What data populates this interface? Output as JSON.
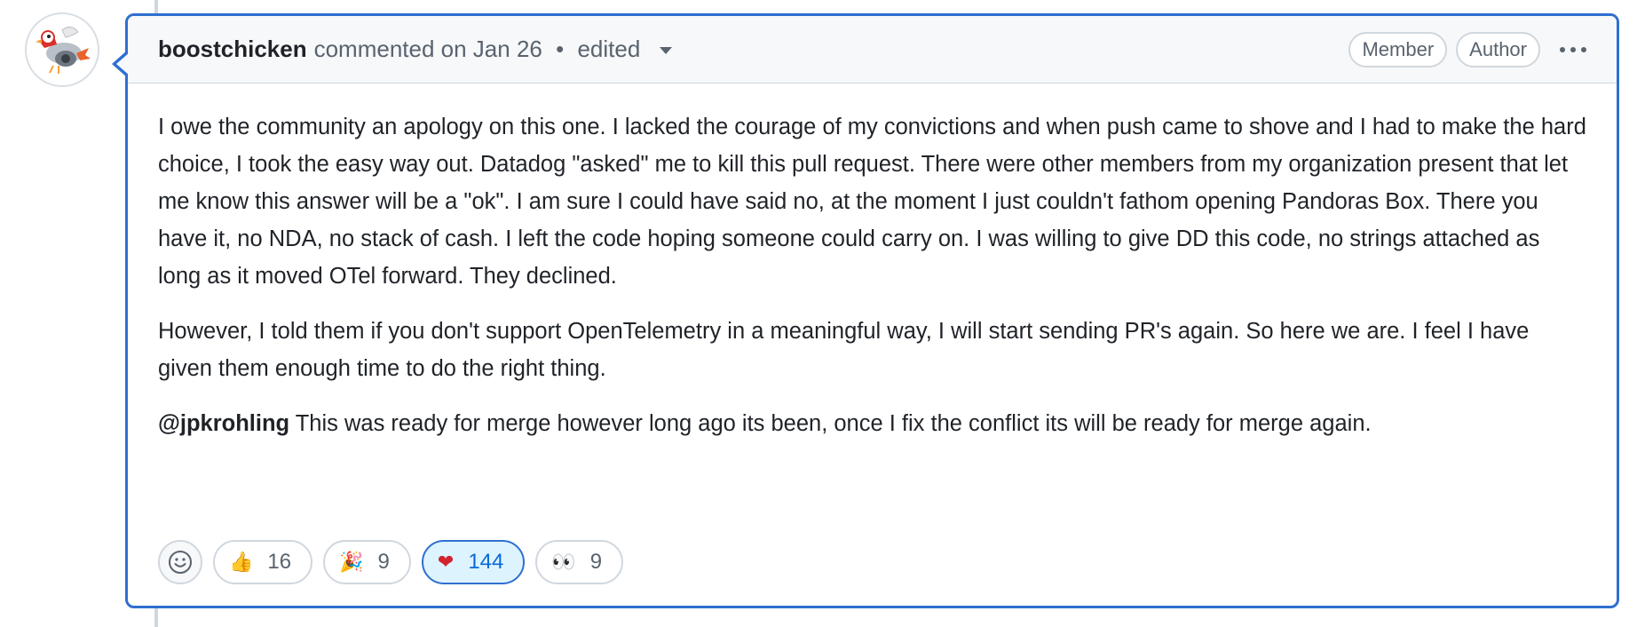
{
  "comment": {
    "author": "boostchicken",
    "action": "commented on Jan 26",
    "separator": "•",
    "edited": "edited",
    "badges": [
      "Member",
      "Author"
    ],
    "paragraphs": [
      "I owe the community an apology on this one. I lacked the courage of my convictions and when push came to shove and I had to make the hard choice, I took the easy way out. Datadog \"asked\" me to kill this pull request. There were other members from my organization present that let me know this answer will be a \"ok\". I am sure I could have said no, at the moment I just couldn't fathom opening Pandoras Box. There you have it, no NDA, no stack of cash. I left the code hoping someone could carry on. I was willing to give DD this code, no strings attached as long as it moved OTel forward. They declined.",
      "However, I told them if you don't support OpenTelemetry in a meaningful way, I will start sending PR's again. So here we are. I feel I have given them enough time to do the right thing."
    ],
    "mention": "@jpkrohling",
    "mention_text": " This was ready for merge however long ago its been, once I fix the conflict its will be ready for merge again."
  },
  "reactions": [
    {
      "emoji": "👍",
      "icon": "thumbs-up-icon",
      "count": "16",
      "active": false
    },
    {
      "emoji": "🎉",
      "icon": "party-popper-icon",
      "count": "9",
      "active": false
    },
    {
      "emoji": "❤",
      "icon": "heart-icon",
      "count": "144",
      "active": true
    },
    {
      "emoji": "👀",
      "icon": "eyes-icon",
      "count": "9",
      "active": false
    }
  ],
  "colors": {
    "accent": "#2f6fd0",
    "heart": "#d1242f"
  }
}
